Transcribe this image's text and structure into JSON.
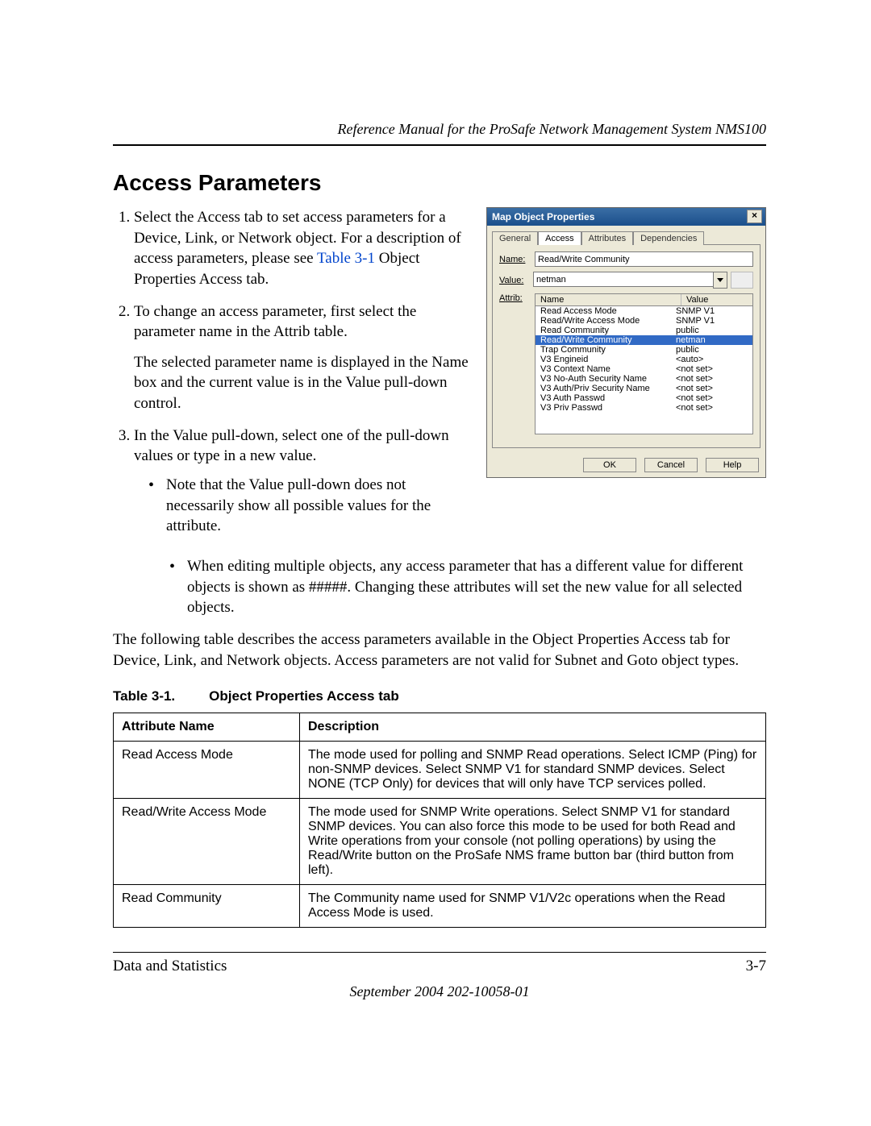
{
  "header": {
    "running_head": "Reference Manual for the ProSafe Network Management System NMS100"
  },
  "section": {
    "title": "Access Parameters"
  },
  "steps": {
    "s1": "Select the Access tab to set access parameters for a Device, Link, or Network object. For a description of access parameters, please see ",
    "s1_link": "Table 3-1",
    "s1_tail": " Object Properties Access tab.",
    "s2": "To change an access parameter, first select the parameter name in the Attrib table.",
    "s2_p": "The selected parameter name is displayed in the Name box and the current value is in the Value pull-down control.",
    "s3": "In the Value pull-down, select one of the pull-down values or type in a new value.",
    "b1": "Note that the Value pull-down does not necessarily show all possible values for the attribute.",
    "b2": "When editing multiple objects, any access parameter that has a different value for different objects is shown as #####. Changing these attributes will set the new value for all selected objects."
  },
  "para_after": "The following table describes the access parameters available in the Object Properties Access tab for Device, Link, and Network objects. Access parameters are not valid for Subnet and Goto object types.",
  "table": {
    "caption_a": "Table 3-1.",
    "caption_b": "Object Properties Access tab",
    "headers": {
      "name": "Attribute Name",
      "desc": "Description"
    },
    "rows": [
      {
        "name": "Read Access Mode",
        "desc": "The mode used for polling and SNMP Read operations. Select ICMP (Ping) for non-SNMP devices. Select SNMP V1 for standard SNMP devices. Select NONE (TCP Only) for devices that will only have TCP services polled."
      },
      {
        "name": "Read/Write Access Mode",
        "desc": "The mode used for SNMP Write operations. Select SNMP V1 for standard SNMP devices. You can also force this mode to be used for both Read and Write operations from your console (not polling operations) by using the Read/Write button on the ProSafe NMS frame button bar (third button from left)."
      },
      {
        "name": "Read Community",
        "desc": "The Community name used for SNMP V1/V2c operations when the Read Access Mode is used."
      }
    ]
  },
  "dialog": {
    "title": "Map Object Properties",
    "tabs": [
      "General",
      "Access",
      "Attributes",
      "Dependencies"
    ],
    "active_tab": 1,
    "labels": {
      "name": "Name:",
      "value": "Value:",
      "attrib": "Attrib:"
    },
    "name_field": "Read/Write Community",
    "value_field": "netman",
    "list_headers": {
      "name": "Name",
      "value": "Value"
    },
    "attribs": [
      {
        "name": "Read Access Mode",
        "value": "SNMP V1"
      },
      {
        "name": "Read/Write Access Mode",
        "value": "SNMP V1"
      },
      {
        "name": "Read Community",
        "value": "public"
      },
      {
        "name": "Read/Write Community",
        "value": "netman"
      },
      {
        "name": "Trap Community",
        "value": "public"
      },
      {
        "name": "V3 Engineid",
        "value": "<auto>"
      },
      {
        "name": "V3 Context Name",
        "value": "<not set>"
      },
      {
        "name": "V3 No-Auth Security Name",
        "value": "<not set>"
      },
      {
        "name": "V3 Auth/Priv Security Name",
        "value": "<not set>"
      },
      {
        "name": "V3 Auth Passwd",
        "value": "<not set>"
      },
      {
        "name": "V3 Priv Passwd",
        "value": "<not set>"
      }
    ],
    "selected_attrib": 3,
    "buttons": {
      "ok": "OK",
      "cancel": "Cancel",
      "help": "Help"
    }
  },
  "footer": {
    "left": "Data and Statistics",
    "right": "3-7",
    "docline": "September 2004 202-10058-01"
  }
}
